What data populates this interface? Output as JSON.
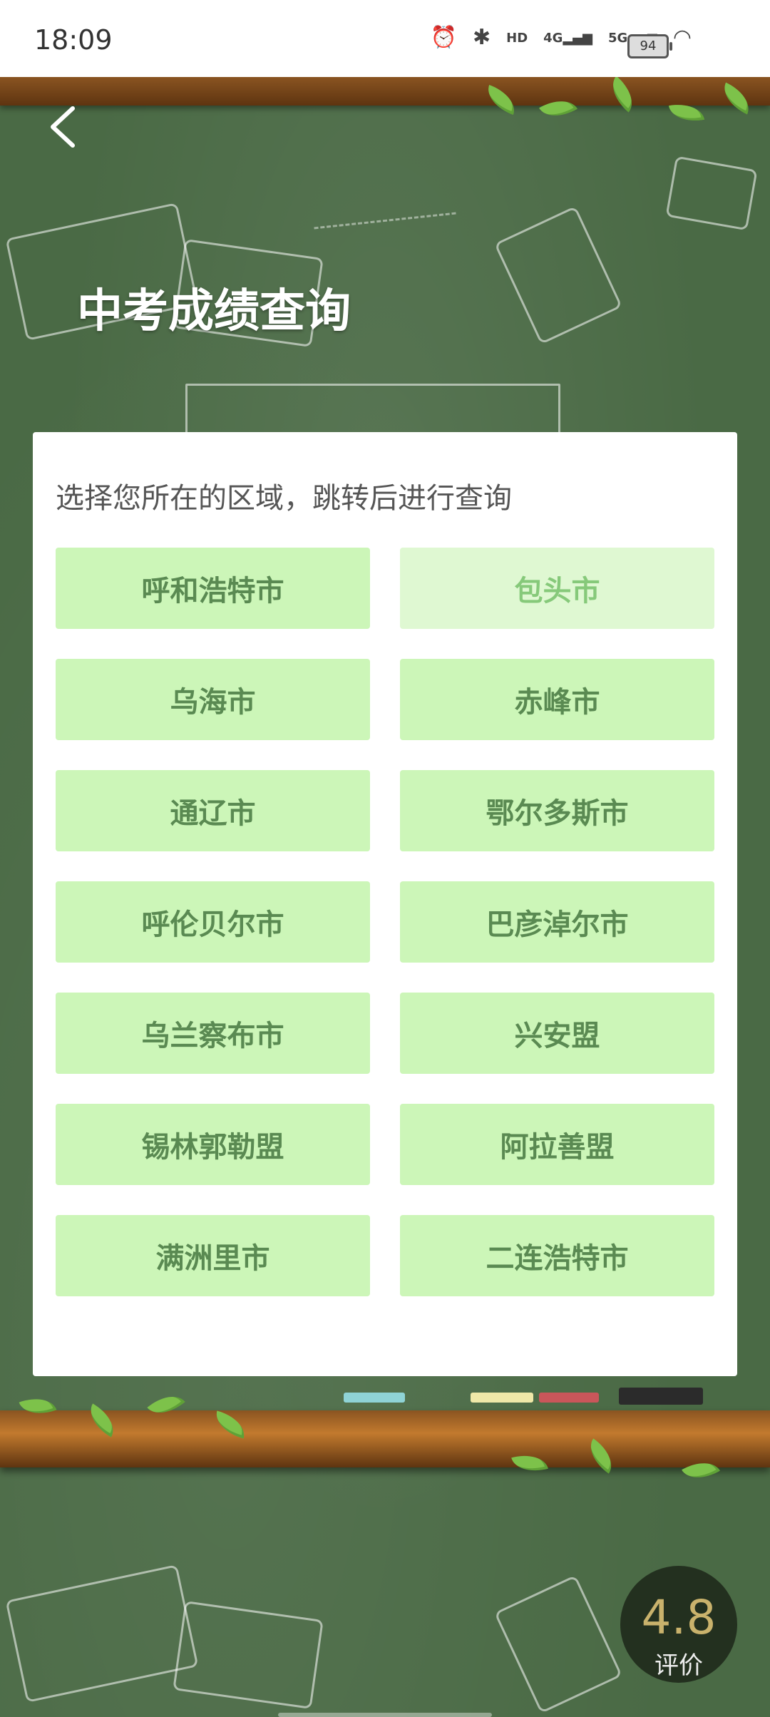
{
  "status_bar": {
    "time": "18:09",
    "battery": "94",
    "icons": [
      "alarm-icon",
      "bluetooth-icon",
      "hd-icon",
      "4g-signal-icon",
      "5g-signal-icon",
      "wifi-icon",
      "battery-icon"
    ]
  },
  "header": {
    "title": "中考成绩查询"
  },
  "card": {
    "instruction": "选择您所在的区域，跳转后进行查询",
    "regions": [
      "呼和浩特市",
      "包头市",
      "乌海市",
      "赤峰市",
      "通辽市",
      "鄂尔多斯市",
      "呼伦贝尔市",
      "巴彦淖尔市",
      "乌兰察布市",
      "兴安盟",
      "锡林郭勒盟",
      "阿拉善盟",
      "满洲里市",
      "二连浩特市"
    ],
    "pressed_region": "包头市"
  },
  "rating": {
    "score": "4.8",
    "label": "评价"
  },
  "colors": {
    "board": "#4a6a45",
    "button_bg": "#ccf6b8",
    "button_text": "#5a8a52",
    "title": "#ffffff",
    "rating_score": "#c9b26c"
  }
}
